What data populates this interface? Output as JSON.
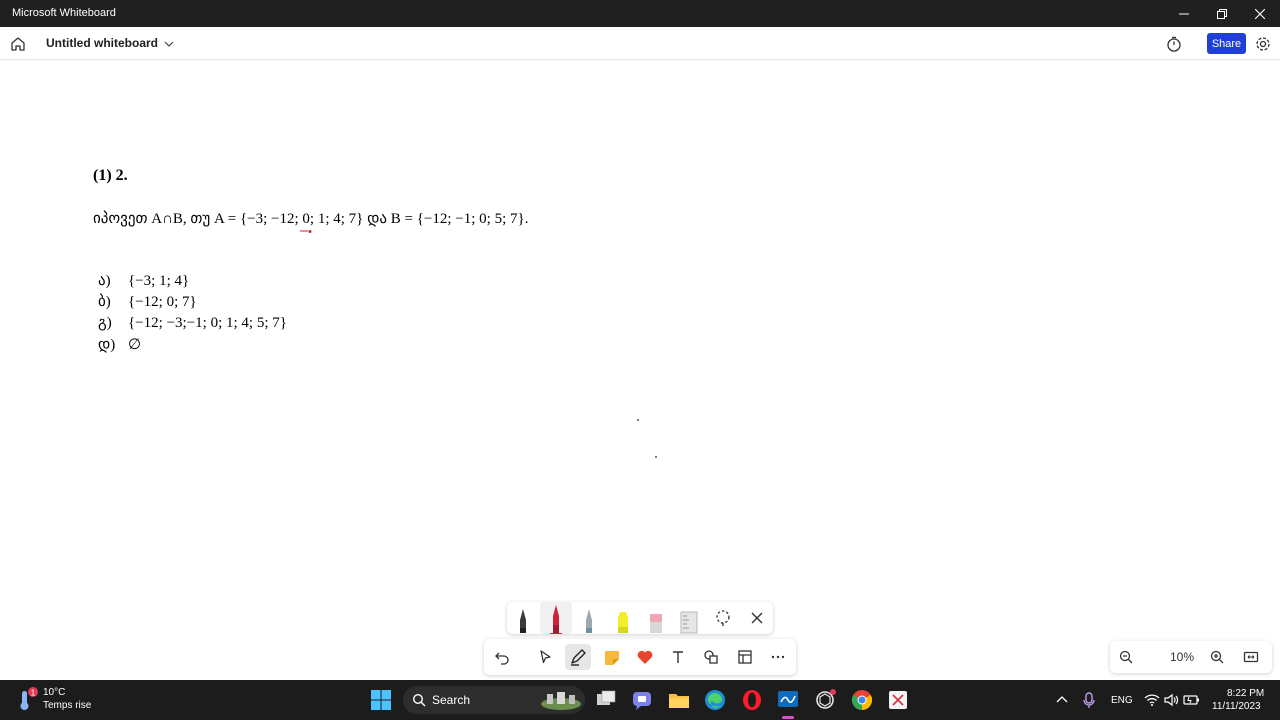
{
  "window": {
    "title": "Microsoft Whiteboard"
  },
  "header": {
    "doc_title": "Untitled whiteboard",
    "share_label": "Share"
  },
  "whiteboard": {
    "question_number": "(1) 2.",
    "question_text": "იპოვეთ A∩B, თუ A = {−3; −12; 0; 1; 4; 7} და B = {−12; −1; 0; 5; 7}.",
    "options": [
      {
        "letter": "ა)",
        "value": "{−3; 1; 4}"
      },
      {
        "letter": "ბ)",
        "value": "{−12; 0;  7}"
      },
      {
        "letter": "გ)",
        "value": "{−12; −3;−1; 0; 1; 4; 5; 7}"
      },
      {
        "letter": "დ)",
        "value": "∅"
      }
    ]
  },
  "pens": [
    {
      "name": "black-pen",
      "color": "#222222"
    },
    {
      "name": "red-pen",
      "color": "#d21f3c",
      "selected": true
    },
    {
      "name": "blue-gray-pen",
      "color": "#6e8ea3"
    },
    {
      "name": "yellow-highlighter",
      "color": "#f2ee2a"
    },
    {
      "name": "pink-eraser",
      "color": "#f2a7b0"
    },
    {
      "name": "ruler",
      "color": "#b8b8b8"
    }
  ],
  "zoom": {
    "level": "10%"
  },
  "taskbar": {
    "weather_temp": "10°C",
    "weather_desc": "Temps rise",
    "weather_badge": "1",
    "search_label": "Search",
    "language": "ENG",
    "time": "8:22 PM",
    "date": "11/11/2023"
  }
}
